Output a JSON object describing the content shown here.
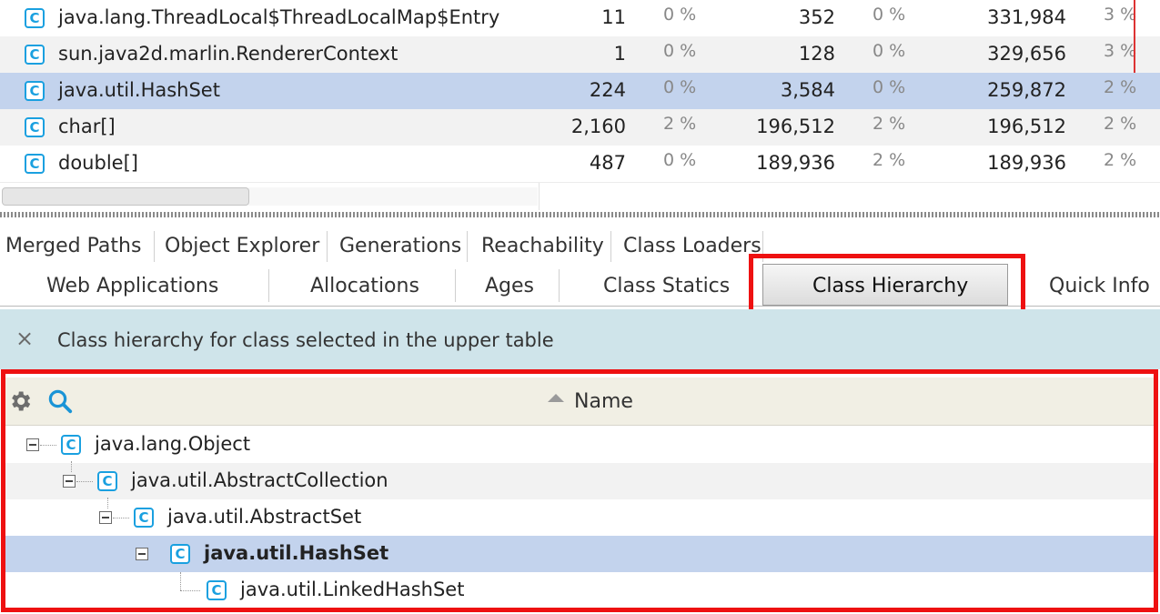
{
  "upper_table": {
    "rows": [
      {
        "name": "java.lang.ThreadLocal$ThreadLocalMap$Entry",
        "count": "11",
        "count_pct": "0 %",
        "shallow": "352",
        "shallow_pct": "0 %",
        "retained": "331,984",
        "retained_pct": "3 %"
      },
      {
        "name": "sun.java2d.marlin.RendererContext",
        "count": "1",
        "count_pct": "0 %",
        "shallow": "128",
        "shallow_pct": "0 %",
        "retained": "329,656",
        "retained_pct": "3 %"
      },
      {
        "name": "java.util.HashSet",
        "count": "224",
        "count_pct": "0 %",
        "shallow": "3,584",
        "shallow_pct": "0 %",
        "retained": "259,872",
        "retained_pct": "2 %"
      },
      {
        "name": "char[]",
        "count": "2,160",
        "count_pct": "2 %",
        "shallow": "196,512",
        "shallow_pct": "2 %",
        "retained": "196,512",
        "retained_pct": "2 %"
      },
      {
        "name": "double[]",
        "count": "487",
        "count_pct": "0 %",
        "shallow": "189,936",
        "shallow_pct": "2 %",
        "retained": "189,936",
        "retained_pct": "2 %"
      }
    ],
    "class_icon_letter": "C"
  },
  "tabs_row1": [
    "Merged Paths",
    "Object Explorer",
    "Generations",
    "Reachability",
    "Class Loaders"
  ],
  "tabs_row2": [
    "Web Applications",
    "Allocations",
    "Ages",
    "Class Statics",
    "Class Hierarchy",
    "Quick Info"
  ],
  "info_bar": {
    "close": "×",
    "message": "Class hierarchy for class selected in the upper table"
  },
  "hierarchy": {
    "column_header": "Name",
    "nodes": [
      {
        "name": "java.lang.Object",
        "depth": 0
      },
      {
        "name": "java.util.AbstractCollection",
        "depth": 1
      },
      {
        "name": "java.util.AbstractSet",
        "depth": 2
      },
      {
        "name": "java.util.HashSet",
        "depth": 3
      },
      {
        "name": "java.util.LinkedHashSet",
        "depth": 4
      }
    ]
  },
  "colors": {
    "selection": "#c3d3ed",
    "highlight_box": "#ee1111",
    "info_bar": "#cfe4ea",
    "class_icon": "#1aa0e0"
  }
}
